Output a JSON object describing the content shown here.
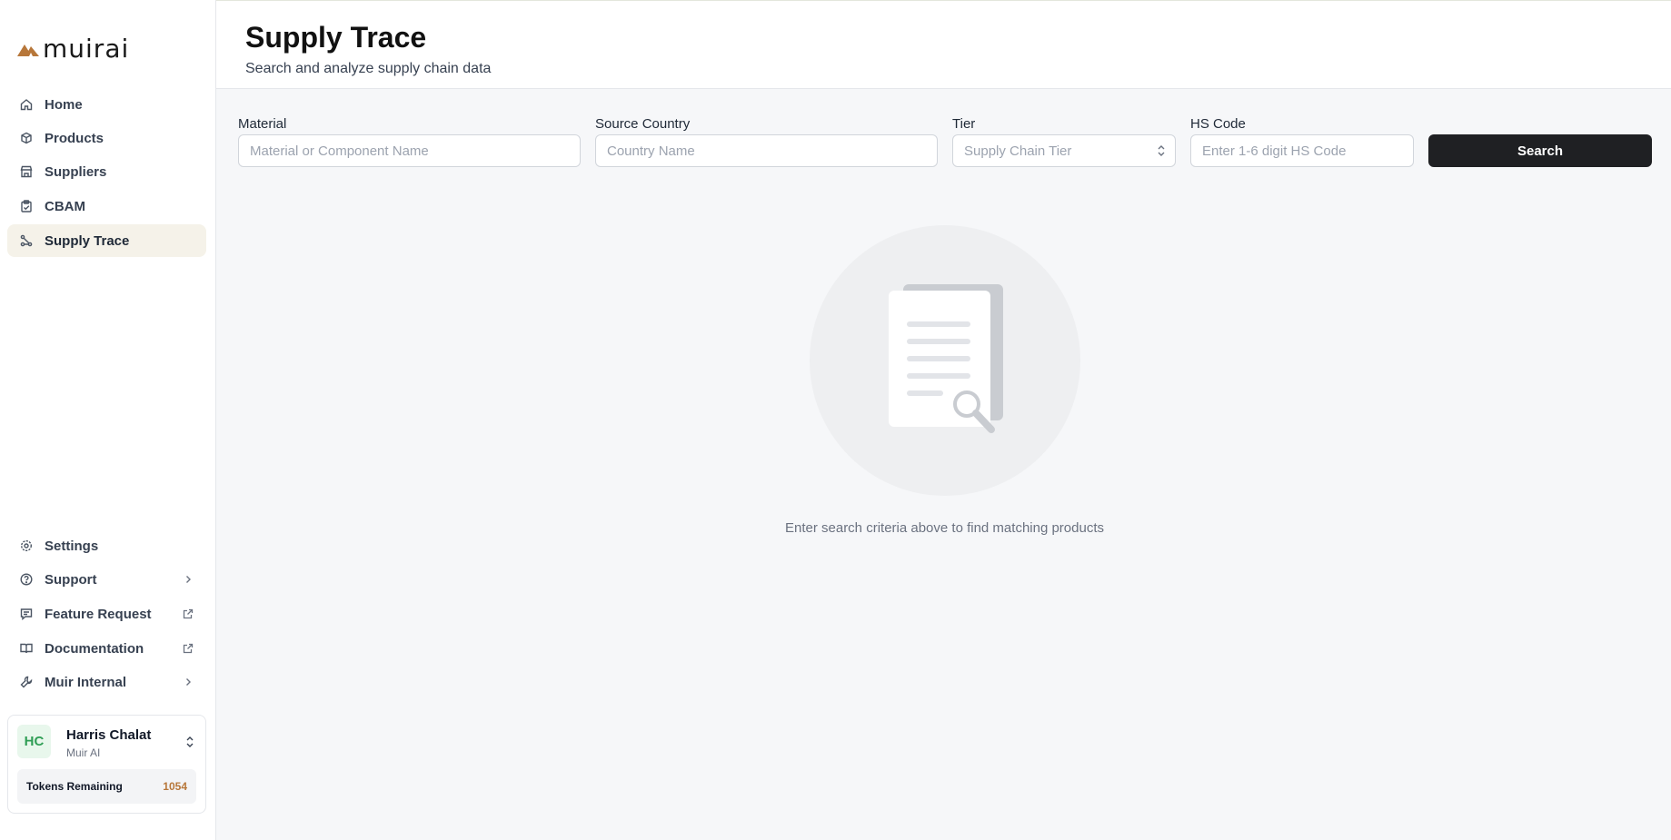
{
  "app": {
    "logo_text": "muirai"
  },
  "sidebar": {
    "nav": [
      {
        "label": "Home",
        "icon": "home-icon"
      },
      {
        "label": "Products",
        "icon": "box-icon"
      },
      {
        "label": "Suppliers",
        "icon": "store-icon"
      },
      {
        "label": "CBAM",
        "icon": "clipboard-icon"
      },
      {
        "label": "Supply Trace",
        "icon": "trace-icon",
        "active": true
      }
    ],
    "bottom_nav": [
      {
        "label": "Settings",
        "icon": "gear-icon"
      },
      {
        "label": "Support",
        "icon": "help-icon",
        "trailing": "chevron-right-icon"
      },
      {
        "label": "Feature Request",
        "icon": "feedback-icon",
        "trailing": "external-link-icon"
      },
      {
        "label": "Documentation",
        "icon": "book-icon",
        "trailing": "external-link-icon"
      },
      {
        "label": "Muir Internal",
        "icon": "wrench-icon",
        "trailing": "chevron-right-icon"
      }
    ],
    "user": {
      "initials": "HC",
      "name": "Harris Chalat",
      "org": "Muir AI",
      "tokens_label": "Tokens Remaining",
      "tokens_value": "1054"
    }
  },
  "header": {
    "title": "Supply Trace",
    "subtitle": "Search and analyze supply chain data"
  },
  "filters": {
    "material": {
      "label": "Material",
      "placeholder": "Material or Component Name",
      "value": ""
    },
    "country": {
      "label": "Source Country",
      "placeholder": "Country Name",
      "value": ""
    },
    "tier": {
      "label": "Tier",
      "placeholder": "Supply Chain Tier"
    },
    "hs_code": {
      "label": "HS Code",
      "placeholder": "Enter 1-6 digit HS Code",
      "value": ""
    },
    "search_label": "Search"
  },
  "empty_state": {
    "message": "Enter search criteria above to find matching products",
    "icon": "document-search-icon"
  },
  "colors": {
    "accent": "#b7773a",
    "active_bg": "#f5f2e9",
    "button_bg": "#1f2023",
    "avatar_bg": "#e8f7ec",
    "avatar_fg": "#2f9e55"
  }
}
